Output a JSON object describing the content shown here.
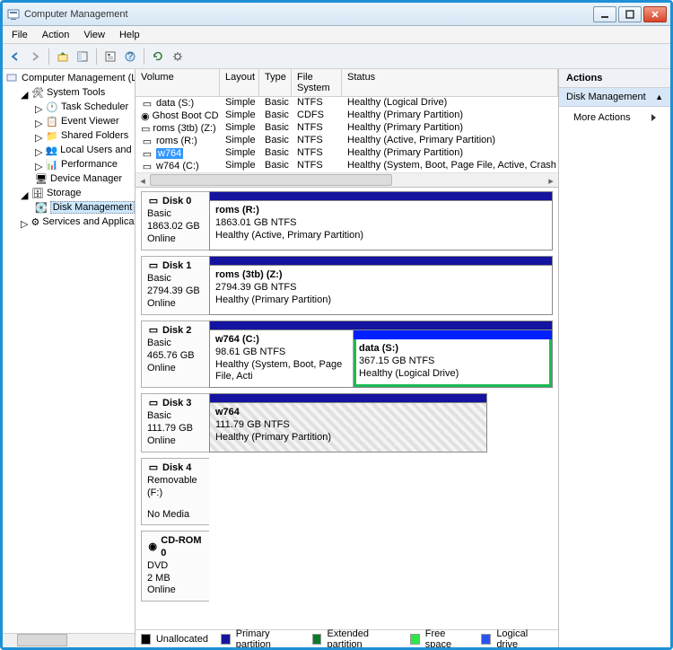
{
  "window": {
    "title": "Computer Management"
  },
  "menu": {
    "file": "File",
    "action": "Action",
    "view": "View",
    "help": "Help"
  },
  "tree": {
    "root": "Computer Management (Local",
    "system_tools": "System Tools",
    "task_scheduler": "Task Scheduler",
    "event_viewer": "Event Viewer",
    "shared_folders": "Shared Folders",
    "local_users": "Local Users and Groups",
    "performance": "Performance",
    "device_manager": "Device Manager",
    "storage": "Storage",
    "disk_management": "Disk Management",
    "services": "Services and Applications"
  },
  "vol_headers": {
    "volume": "Volume",
    "layout": "Layout",
    "type": "Type",
    "fs": "File System",
    "status": "Status"
  },
  "volumes": [
    {
      "name": "data (S:)",
      "layout": "Simple",
      "type": "Basic",
      "fs": "NTFS",
      "status": "Healthy (Logical Drive)"
    },
    {
      "name": "Ghost Boot CD (D:)",
      "layout": "Simple",
      "type": "Basic",
      "fs": "CDFS",
      "status": "Healthy (Primary Partition)"
    },
    {
      "name": "roms (3tb) (Z:)",
      "layout": "Simple",
      "type": "Basic",
      "fs": "NTFS",
      "status": "Healthy (Primary Partition)"
    },
    {
      "name": "roms (R:)",
      "layout": "Simple",
      "type": "Basic",
      "fs": "NTFS",
      "status": "Healthy (Active, Primary Partition)"
    },
    {
      "name": "w764",
      "layout": "Simple",
      "type": "Basic",
      "fs": "NTFS",
      "status": "Healthy (Primary Partition)"
    },
    {
      "name": "w764 (C:)",
      "layout": "Simple",
      "type": "Basic",
      "fs": "NTFS",
      "status": "Healthy (System, Boot, Page File, Active, Crash Dump, Primary P"
    }
  ],
  "disks": {
    "d0": {
      "name": "Disk 0",
      "type": "Basic",
      "size": "1863.02 GB",
      "state": "Online",
      "p0": {
        "name": "roms  (R:)",
        "size": "1863.01 GB NTFS",
        "status": "Healthy (Active, Primary Partition)"
      }
    },
    "d1": {
      "name": "Disk 1",
      "type": "Basic",
      "size": "2794.39 GB",
      "state": "Online",
      "p0": {
        "name": "roms (3tb)  (Z:)",
        "size": "2794.39 GB NTFS",
        "status": "Healthy (Primary Partition)"
      }
    },
    "d2": {
      "name": "Disk 2",
      "type": "Basic",
      "size": "465.76 GB",
      "state": "Online",
      "p0": {
        "name": "w764  (C:)",
        "size": "98.61 GB NTFS",
        "status": "Healthy (System, Boot, Page File, Acti"
      },
      "p1": {
        "name": "data  (S:)",
        "size": "367.15 GB NTFS",
        "status": "Healthy (Logical Drive)"
      }
    },
    "d3": {
      "name": "Disk 3",
      "type": "Basic",
      "size": "111.79 GB",
      "state": "Online",
      "p0": {
        "name": "w764",
        "size": "111.79 GB NTFS",
        "status": "Healthy (Primary Partition)"
      }
    },
    "d4": {
      "name": "Disk 4",
      "type": "Removable (F:)",
      "nomedia": "No Media"
    },
    "cd0": {
      "name": "CD-ROM 0",
      "type": "DVD",
      "size": "2 MB",
      "state": "Online"
    }
  },
  "legend": {
    "unalloc": "Unallocated",
    "primary": "Primary partition",
    "ext": "Extended partition",
    "free": "Free space",
    "logical": "Logical drive"
  },
  "actions": {
    "header": "Actions",
    "dm": "Disk Management",
    "more": "More Actions"
  }
}
